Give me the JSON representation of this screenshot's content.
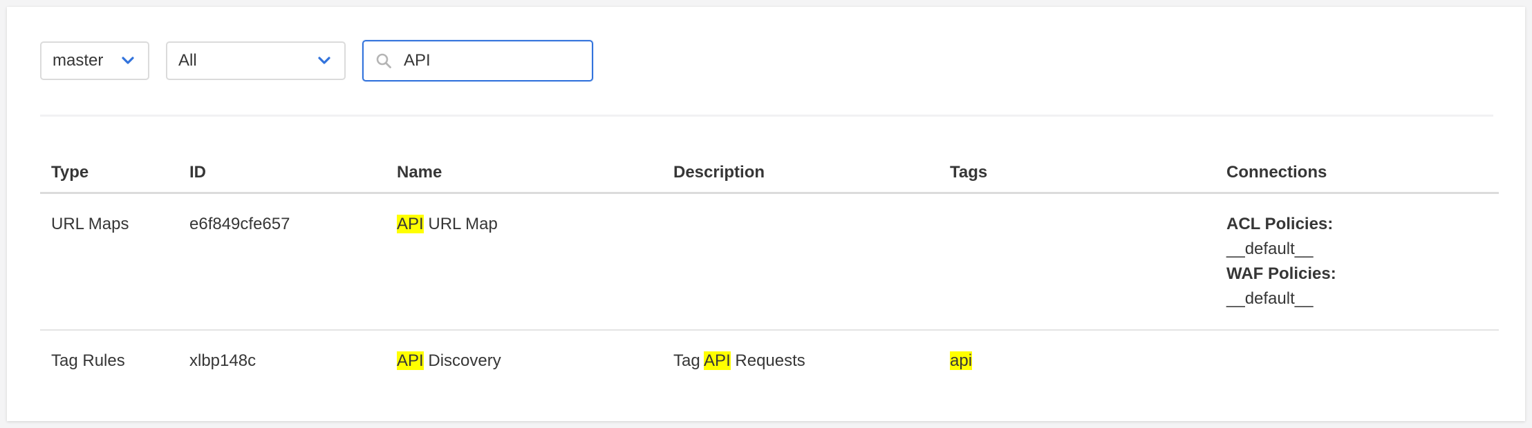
{
  "filters": {
    "branch_value": "master",
    "type_value": "All",
    "search_value": "API"
  },
  "table": {
    "headers": [
      "Type",
      "ID",
      "Name",
      "Description",
      "Tags",
      "Connections"
    ],
    "rows": [
      {
        "type": "URL Maps",
        "id": "e6f849cfe657",
        "name_highlight": "API",
        "name_rest": " URL Map",
        "description_before": "",
        "description_highlight": "",
        "description_after": "",
        "tags_highlight": "",
        "connections": [
          {
            "label": "ACL Policies:",
            "value": "__default__"
          },
          {
            "label": "WAF Policies:",
            "value": "__default__"
          }
        ]
      },
      {
        "type": "Tag Rules",
        "id": "xlbp148c",
        "name_highlight": "API",
        "name_rest": " Discovery",
        "description_before": "Tag ",
        "description_highlight": "API",
        "description_after": " Requests",
        "tags_highlight": "api",
        "connections": []
      }
    ]
  },
  "colors": {
    "accent": "#3273dc",
    "highlight": "#ffff00"
  },
  "icons": {
    "dropdown": "chevron-down-icon",
    "search": "search-icon"
  }
}
